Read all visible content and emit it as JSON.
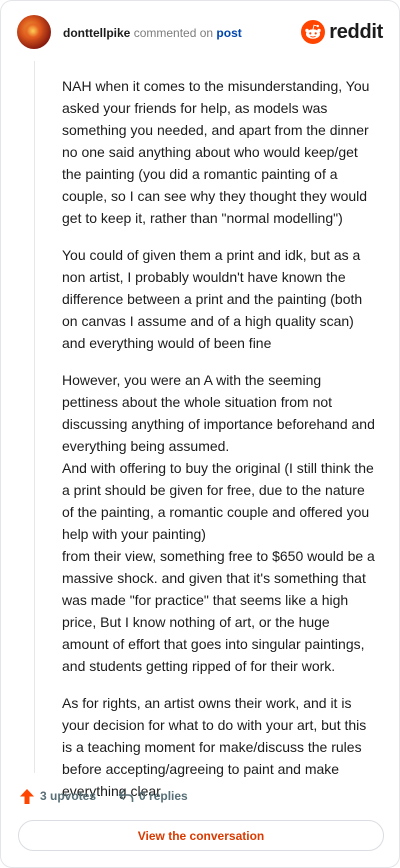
{
  "header": {
    "username": "donttellpike",
    "commented_on": "commented on",
    "post_link": "post",
    "brand": "reddit"
  },
  "comment": {
    "paragraphs": [
      "NAH when it comes to the misunderstanding, You asked your friends for help, as models was something you needed, and apart from the dinner no one said anything about who would keep/get the painting (you did a romantic painting of a couple, so I can see why they thought they would get to keep it, rather than \"normal modelling\")",
      "You could of given them a print and idk, but as a non artist, I probably wouldn't have known the difference between a print and the painting (both on canvas I assume and of a high quality scan) and everything would of been fine",
      "However, you were an A with the seeming pettiness about the whole situation from not discussing anything of importance beforehand and everything being assumed.\nAnd with offering to buy the original (I still think the a print should be given for free, due to the nature of the painting, a romantic couple and offered you help with your painting)\nfrom their view, something free to $650 would be a massive shock. and given that it's something that was made \"for practice\" that seems like a high price, But I know nothing of art, or the huge amount of effort that goes into singular paintings, and students getting ripped of for their work.",
      "As for rights, an artist owns their work, and it is your decision for what to do with your art, but this is a teaching moment for make/discuss the rules before accepting/agreeing to paint and make everything clear"
    ]
  },
  "actions": {
    "upvotes": "3 upvotes",
    "replies": "0 replies",
    "upvote_icon": "upvote-arrow-icon",
    "reply_icon": "reply-arrow-icon",
    "upvote_color": "#ff4500"
  },
  "view_button": "View the conversation",
  "colors": {
    "accent": "#ff4500",
    "link": "#0045ac",
    "button_text": "#d93a00"
  }
}
